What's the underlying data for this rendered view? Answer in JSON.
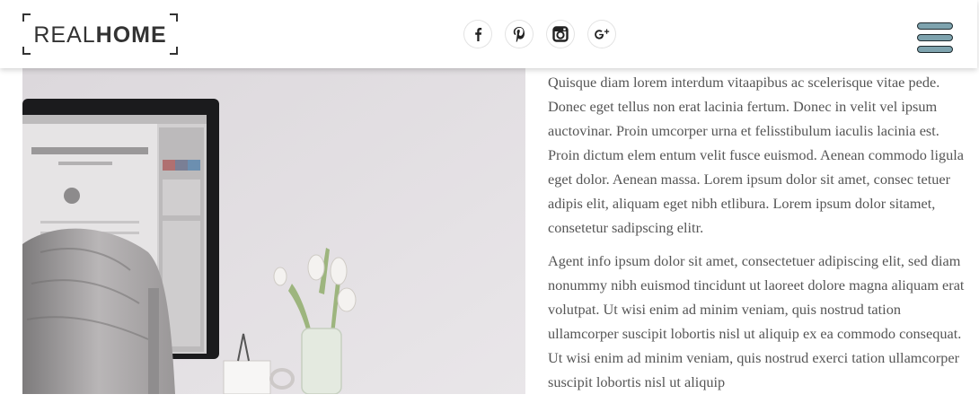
{
  "brand": {
    "name_light": "REAL",
    "name_bold": "HOME"
  },
  "social": {
    "icons": [
      "facebook-icon",
      "pinterest-icon",
      "instagram-icon",
      "google-plus-icon"
    ]
  },
  "menu": {
    "icon": "hamburger-menu-icon",
    "bar_color": "#7ea3ae"
  },
  "hero_image": {
    "description_icon": "desk-photo"
  },
  "article": {
    "paragraphs": [
      "Quisque diam lorem interdum vitaapibus ac scelerisque vitae pede. Donec eget tellus non erat lacinia fertum. Donec in velit vel ipsum auctovinar. Proin umcorper urna et felisstibulum iaculis lacinia est. Proin dictum elem entum velit fusce euismod. Aenean commodo ligula eget dolor. Aenean massa. Lorem ipsum dolor sit amet, consec tetuer adipis elit, aliquam eget nibh etlibura. Lorem ipsum dolor sitamet, consetetur sadipscing elitr.",
      "Agent info ipsum dolor sit amet, consectetuer adipiscing elit, sed diam nonummy nibh euismod tincidunt ut laoreet dolore magna aliquam erat volutpat. Ut wisi enim ad minim veniam, quis nostrud tation ullamcorper suscipit lobortis nisl ut aliquip ex ea commodo consequat. Ut wisi enim ad minim veniam, quis nostrud exerci tation ullamcorper suscipit lobortis nisl ut aliquip"
    ]
  }
}
